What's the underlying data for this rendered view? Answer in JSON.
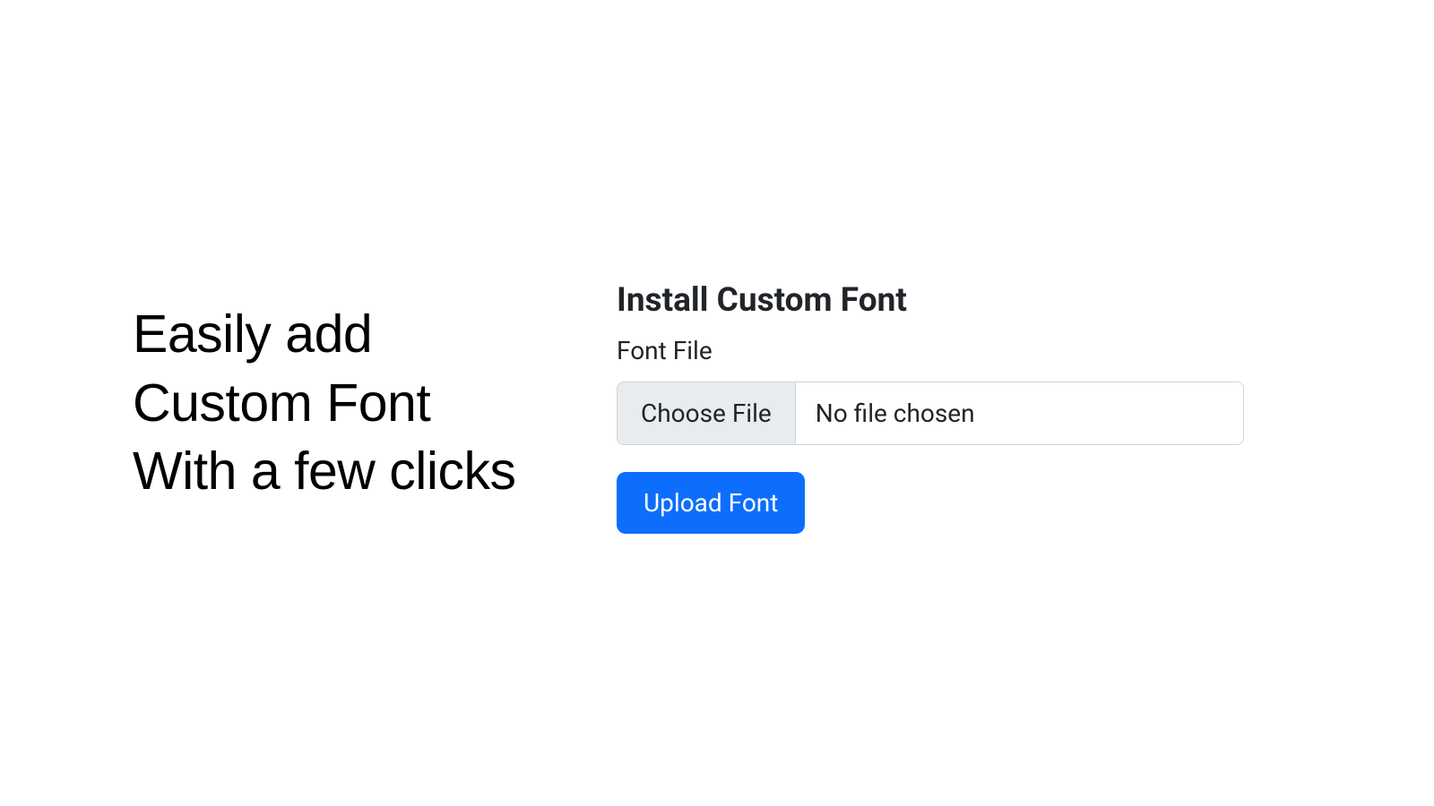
{
  "headline": {
    "line1": "Easily add",
    "line2": "Custom Font",
    "line3": "With a few clicks"
  },
  "form": {
    "title": "Install Custom Font",
    "file_label": "Font File",
    "choose_button": "Choose File",
    "no_file_text": "No file chosen",
    "upload_button": "Upload Font"
  },
  "colors": {
    "primary": "#0d6efd",
    "text": "#212529",
    "border": "#ced4da",
    "button_bg": "#e9ecef"
  }
}
